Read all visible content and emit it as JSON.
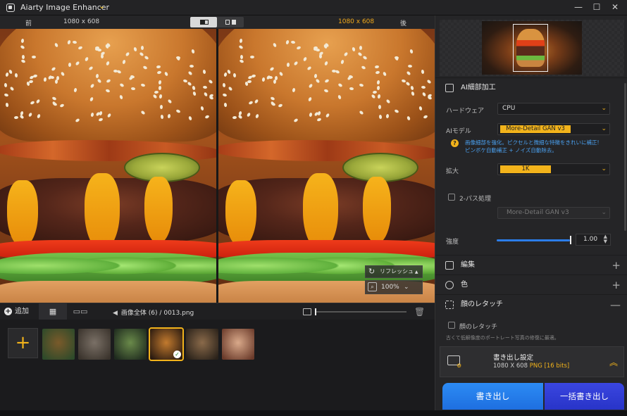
{
  "titlebar": {
    "title": "Aiarty Image Enhancer",
    "chevron": "⌄",
    "min": "—",
    "max": "☐",
    "close": "✕"
  },
  "compare": {
    "before_label": "前",
    "after_label": "後",
    "size_left": "1080 x 608",
    "size_right": "1080 x 608"
  },
  "overlay": {
    "refresh": "リフレッシュ",
    "zoom": "100%",
    "zoom_chev": "⌄"
  },
  "filebar": {
    "add": "追加",
    "grid_icon": "▦",
    "film_icon": "▭▭",
    "crumb_all": "画像全体 (6)",
    "crumb_sep": "/",
    "crumb_file": "0013.png"
  },
  "thumbs": {
    "add_symbol": "+",
    "items": [
      {
        "name": "tiger",
        "c1": "#7a5a2a",
        "c2": "#2d4a2a"
      },
      {
        "name": "owl",
        "c1": "#7a7066",
        "c2": "#3a332c"
      },
      {
        "name": "forest-scene",
        "c1": "#6a8a4a",
        "c2": "#1e2a1e"
      },
      {
        "name": "burger",
        "c1": "#c27a2e",
        "c2": "#2a1a10",
        "selected": true
      },
      {
        "name": "dog",
        "c1": "#8a6a4a",
        "c2": "#2a221a"
      },
      {
        "name": "portrait",
        "c1": "#d9a98a",
        "c2": "#6a3a2a"
      }
    ]
  },
  "panel": {
    "ai_section": "AI細部加工",
    "hardware_label": "ハードウェア",
    "hardware_value": "CPU",
    "model_label": "AIモデル",
    "model_value": "More-Detail GAN  v3",
    "hint_line1": "画像細部を強化。ピクセルと微細な特徴をきれいに補正!",
    "hint_line2": "ピンボケ自動補正 + ノイズ自動除去。",
    "scale_label": "拡大",
    "scale_value": "1K",
    "twopass_label": "2-パス処理",
    "twopass_model": "More-Detail GAN  v3",
    "strength_label": "強度",
    "strength_value": "1.00",
    "strength_fraction": 1.0,
    "edit_section": "編集",
    "color_section": "色",
    "face_section": "顔のレタッチ",
    "face_checkbox": "顔のレタッチ",
    "face_desc": "古くて低解像度のポートレート写真の修復に最適。",
    "plus": "+",
    "minus": "—"
  },
  "export": {
    "title": "書き出し設定",
    "size": "1080 X 608",
    "format": "PNG",
    "bits": "[16 bits]",
    "export_btn": "書き出し",
    "batch_btn": "一括書き出し"
  },
  "colors": {
    "accent": "#f2b31b",
    "blue": "#2b7de9",
    "hint": "#4aa0ef"
  }
}
